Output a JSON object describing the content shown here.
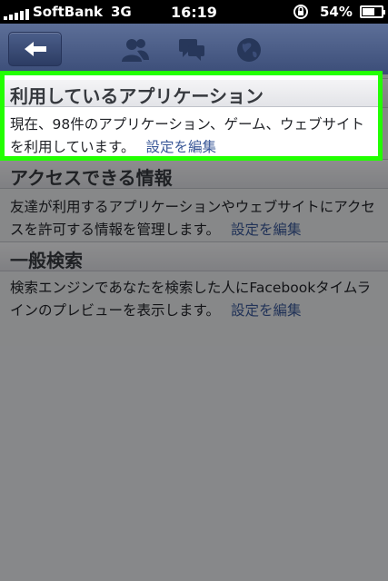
{
  "status_bar": {
    "carrier": "SoftBank",
    "network": "3G",
    "time": "16:19",
    "battery": "54%"
  },
  "nav_bar": {
    "icons": [
      "back-arrow-icon",
      "friends-icon",
      "messages-icon",
      "globe-icon"
    ]
  },
  "sections": [
    {
      "title": "利用しているアプリケーション",
      "body": "現在、98件のアプリケーション、ゲーム、ウェブサイトを利用しています。",
      "link": "設定を編集"
    },
    {
      "title": "アクセスできる情報",
      "body": "友達が利用するアプリケーションやウェブサイトにアクセスを許可する情報を管理します。",
      "link": "設定を編集"
    },
    {
      "title": "一般検索",
      "body": "検索エンジンであなたを検索した人にFacebookタイムラインのプレビューを表示します。",
      "link": "設定を編集"
    }
  ],
  "colors": {
    "highlight": "#22ff00",
    "nav": "#3b4d78",
    "link": "#3b5998"
  }
}
